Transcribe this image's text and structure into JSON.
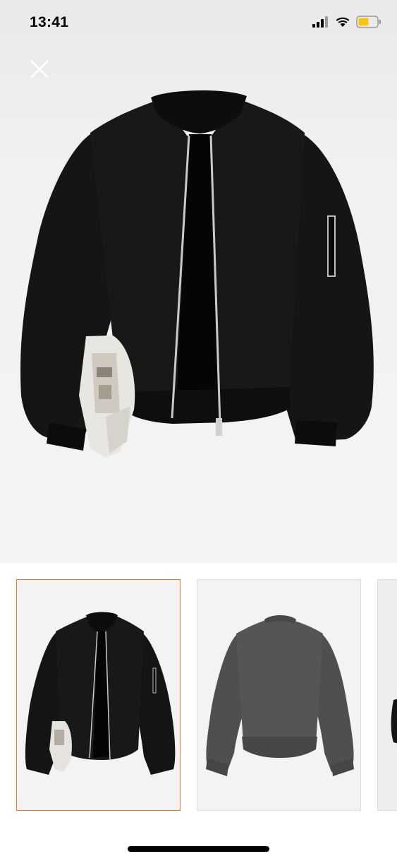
{
  "status_bar": {
    "time": "13:41",
    "icons": [
      "cellular-signal-icon",
      "wifi-icon",
      "battery-icon"
    ],
    "battery_color": "#f5c518"
  },
  "hero": {
    "close_icon": "close-icon",
    "image": "black-bomber-jacket-front-with-newspaper",
    "background": "#f1f1f1"
  },
  "thumbnails": [
    {
      "image": "black-bomber-jacket-front",
      "selected": true
    },
    {
      "image": "grey-bomber-jacket-back",
      "selected": false
    },
    {
      "image": "model-wearing-jacket-partial",
      "selected": false
    }
  ],
  "colors": {
    "selected_border": "#f07a2a",
    "jacket": "#141414",
    "back_view_jacket": "#4f4f4d"
  }
}
